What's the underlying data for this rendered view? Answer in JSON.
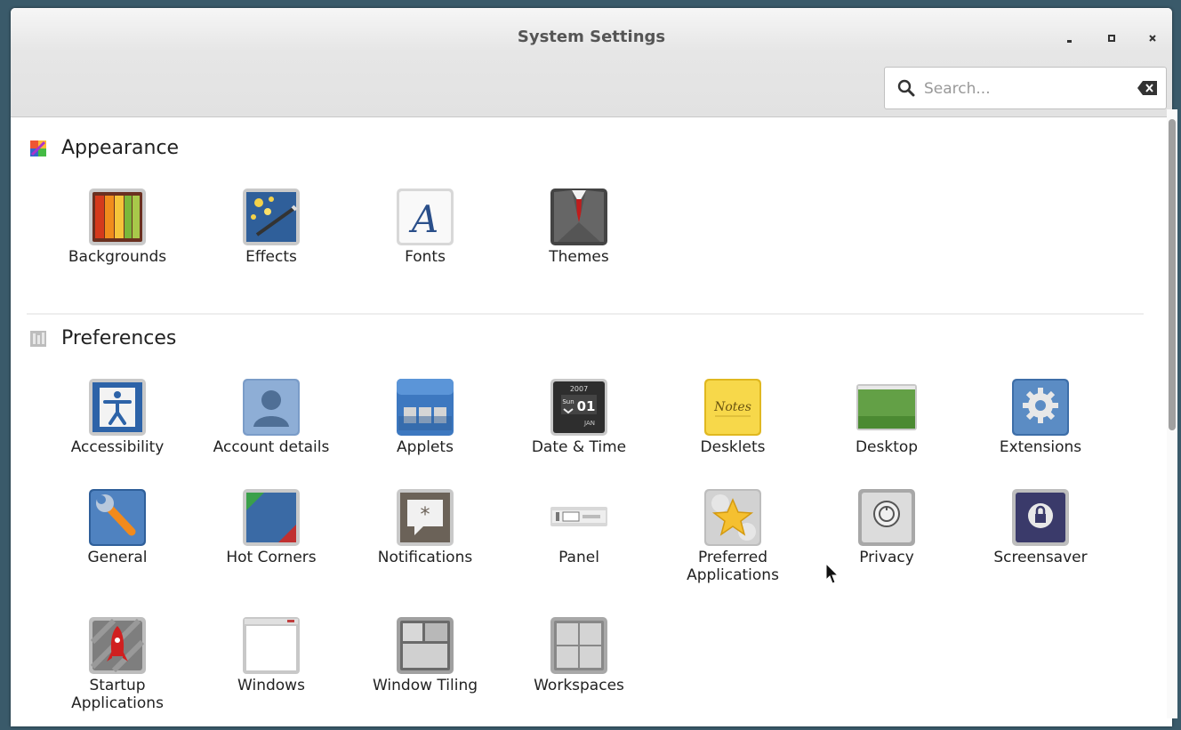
{
  "window": {
    "title": "System Settings",
    "controls": {
      "minimize": "-",
      "maximize": "▪",
      "close": "×"
    }
  },
  "search": {
    "placeholder": "Search...",
    "value": ""
  },
  "sections": {
    "appearance": {
      "title": "Appearance",
      "items": [
        {
          "label": "Backgrounds",
          "icon": "backgrounds-icon"
        },
        {
          "label": "Effects",
          "icon": "effects-icon"
        },
        {
          "label": "Fonts",
          "icon": "fonts-icon"
        },
        {
          "label": "Themes",
          "icon": "themes-icon"
        }
      ]
    },
    "preferences": {
      "title": "Preferences",
      "items": [
        {
          "label": "Accessibility",
          "icon": "accessibility-icon"
        },
        {
          "label": "Account details",
          "icon": "account-details-icon"
        },
        {
          "label": "Applets",
          "icon": "applets-icon"
        },
        {
          "label": "Date & Time",
          "icon": "date-time-icon"
        },
        {
          "label": "Desklets",
          "icon": "desklets-icon"
        },
        {
          "label": "Desktop",
          "icon": "desktop-icon"
        },
        {
          "label": "Extensions",
          "icon": "extensions-icon"
        },
        {
          "label": "General",
          "icon": "general-icon"
        },
        {
          "label": "Hot Corners",
          "icon": "hot-corners-icon"
        },
        {
          "label": "Notifications",
          "icon": "notifications-icon"
        },
        {
          "label": "Panel",
          "icon": "panel-icon"
        },
        {
          "label": "Preferred Applications",
          "icon": "preferred-applications-icon"
        },
        {
          "label": "Privacy",
          "icon": "privacy-icon"
        },
        {
          "label": "Screensaver",
          "icon": "screensaver-icon"
        },
        {
          "label": "Startup Applications",
          "icon": "startup-applications-icon"
        },
        {
          "label": "Windows",
          "icon": "windows-icon"
        },
        {
          "label": "Window Tiling",
          "icon": "window-tiling-icon"
        },
        {
          "label": "Workspaces",
          "icon": "workspaces-icon"
        }
      ]
    }
  },
  "icon_text": {
    "fonts_glyph": "A",
    "date_year": "2007",
    "date_day": "Sun",
    "date_num": "01",
    "date_month": "JAN",
    "desklets_note": "Notes",
    "notifications_glyph": "*"
  }
}
